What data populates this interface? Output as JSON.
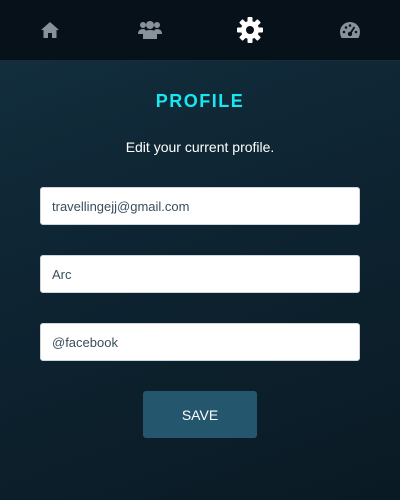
{
  "nav": {
    "items": [
      {
        "icon": "home-icon",
        "active": false
      },
      {
        "icon": "users-icon",
        "active": false
      },
      {
        "icon": "gear-icon",
        "active": true
      },
      {
        "icon": "dashboard-gauge-icon",
        "active": false
      }
    ],
    "active_color": "#ffffff",
    "inactive_color": "#8a9299"
  },
  "profile": {
    "title": "PROFILE",
    "subtitle": "Edit your current profile.",
    "fields": {
      "email": "travellingejj@gmail.com",
      "name": "Arc",
      "social": "@facebook"
    },
    "save_label": "SAVE"
  },
  "colors": {
    "title": "#19e6f0",
    "button": "#24566e"
  }
}
